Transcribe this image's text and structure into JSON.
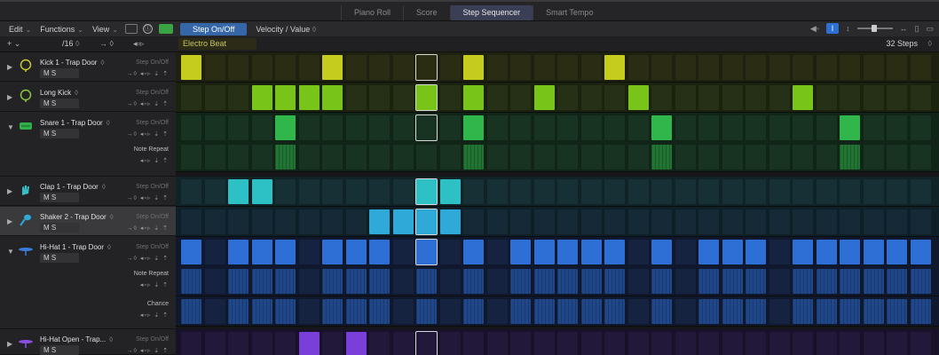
{
  "tabs": [
    {
      "label": "Piano Roll",
      "active": false
    },
    {
      "label": "Score",
      "active": false
    },
    {
      "label": "Step Sequencer",
      "active": true
    },
    {
      "label": "Smart Tempo",
      "active": false
    }
  ],
  "toolbar": {
    "edit": "Edit",
    "functions": "Functions",
    "view": "View",
    "info_glyph": "ⓘ",
    "step_mode": "Step On/Off",
    "velocity": "Velocity / Value"
  },
  "header": {
    "add": "+",
    "resolution": "/16",
    "pattern_name": "Electro Beat",
    "steps_label": "32 Steps"
  },
  "icons": {
    "kick": "drum-icon",
    "clap": "hand-icon",
    "shaker": "maraca-icon",
    "hihat": "cymbal-icon"
  },
  "colors": {
    "yellow": "#c6cc1e",
    "lime": "#79c418",
    "green": "#30b64a",
    "teal": "#2dc0c4",
    "cyan": "#2ea9d8",
    "blue": "#2e6fd6",
    "purple": "#7a3fd8"
  },
  "rows": [
    {
      "name": "Kick 1 - Trap Door",
      "mode": "Step On/Off",
      "ms": "M S",
      "on": [
        0,
        6,
        12,
        18
      ],
      "sub": false
    },
    {
      "name": "Long Kick",
      "mode": "Step On/Off",
      "ms": "M S",
      "on": [
        3,
        4,
        5,
        6,
        10,
        12,
        15,
        19,
        26
      ],
      "sub": false
    },
    {
      "name": "Snare 1 - Trap Door",
      "mode": "Step On/Off",
      "ms": "M S",
      "on": [
        4,
        12,
        20,
        28
      ],
      "sub": true,
      "sublabel": "Note Repeat"
    },
    {
      "name": "Clap 1 - Trap Door",
      "mode": "Step On/Off",
      "ms": "M S",
      "on": [
        2,
        3,
        10,
        11
      ],
      "sub": false
    },
    {
      "name": "Shaker 2 - Trap Door",
      "mode": "Step On/Off",
      "ms": "M S",
      "on": [
        8,
        9,
        10,
        11
      ],
      "sub": false
    },
    {
      "name": "Hi-Hat 1 - Trap Door",
      "mode": "Step On/Off",
      "ms": "M S",
      "on": [
        0,
        2,
        3,
        4,
        6,
        7,
        8,
        10,
        12,
        14,
        15,
        16,
        17,
        18,
        20,
        22,
        23,
        24,
        26,
        27,
        28,
        29,
        30,
        31
      ],
      "sub": true,
      "sublabel": "Note Repeat",
      "sublabel2": "Chance"
    },
    {
      "name": "Hi-Hat Open - Trap...",
      "mode": "Step On/Off",
      "ms": "M S",
      "on": [
        5,
        7
      ],
      "sub": false
    }
  ]
}
